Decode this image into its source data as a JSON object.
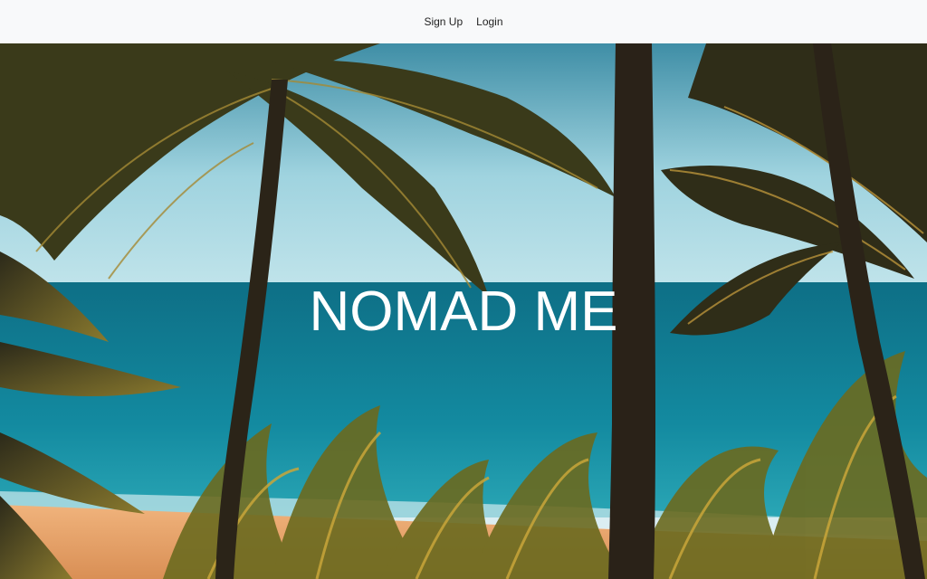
{
  "nav": {
    "signup_label": "Sign Up",
    "login_label": "Login"
  },
  "hero": {
    "title": "NOMAD ME",
    "image_description_icon": "palm-beach-photo"
  },
  "colors": {
    "navbar_bg": "#f8f9fa",
    "sky": "#7fc4d8",
    "sea": "#127a8e",
    "sand": "#e9a468",
    "title": "#ffffff"
  }
}
